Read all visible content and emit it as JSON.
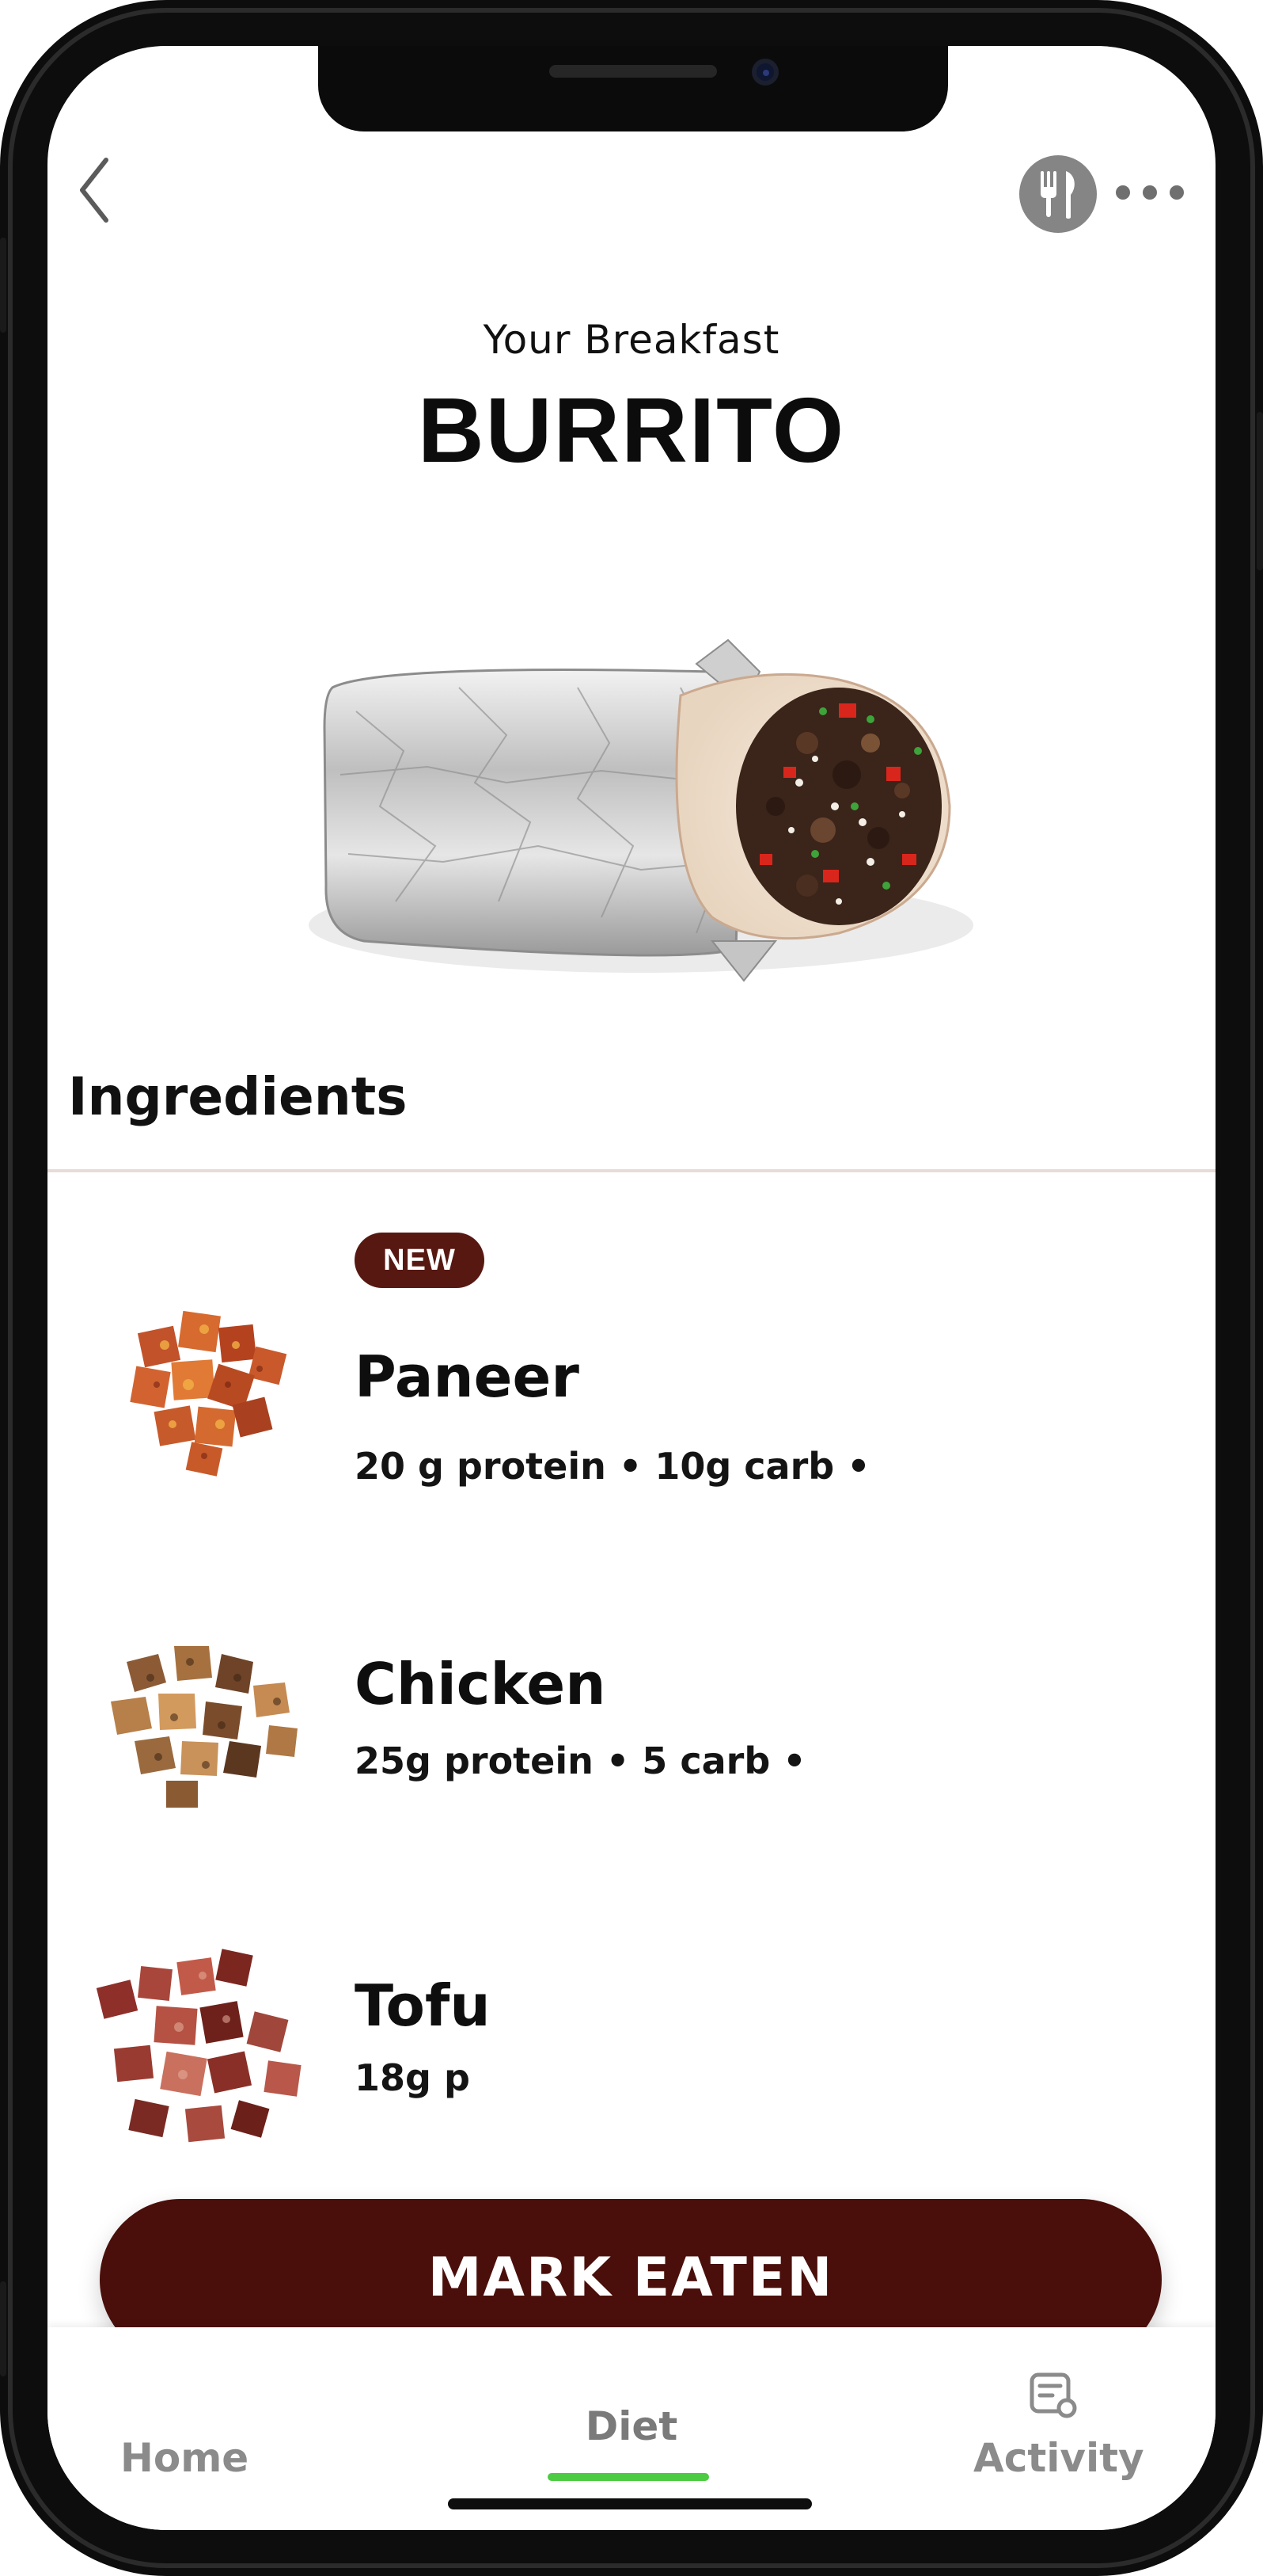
{
  "header": {
    "subtitle": "Your Breakfast",
    "title": "BURRITO",
    "icons": [
      "back-chevron-icon",
      "utensils-icon",
      "more-dots-icon"
    ]
  },
  "ingredients": {
    "section_title": "Ingredients",
    "items": [
      {
        "name": "Paneer",
        "badge": "NEW",
        "macro": "20 g protein • 10g carb •",
        "image": "paneer-cubes-icon"
      },
      {
        "name": "Chicken",
        "macro": "25g protein • 5 carb •",
        "image": "chicken-pieces-icon"
      },
      {
        "name": "Tofu",
        "macro": "18g p",
        "image": "tofu-cubes-icon"
      }
    ]
  },
  "cta": {
    "label": "MARK EATEN"
  },
  "tabbar": {
    "tabs": [
      {
        "label": "Home"
      },
      {
        "label": "Diet",
        "active": true
      },
      {
        "label": "Activity"
      }
    ]
  },
  "colors": {
    "accent": "#4a0f0b",
    "badge": "#571812",
    "active_tab_indicator": "#4ccb43",
    "icon_gray": "#858585"
  }
}
